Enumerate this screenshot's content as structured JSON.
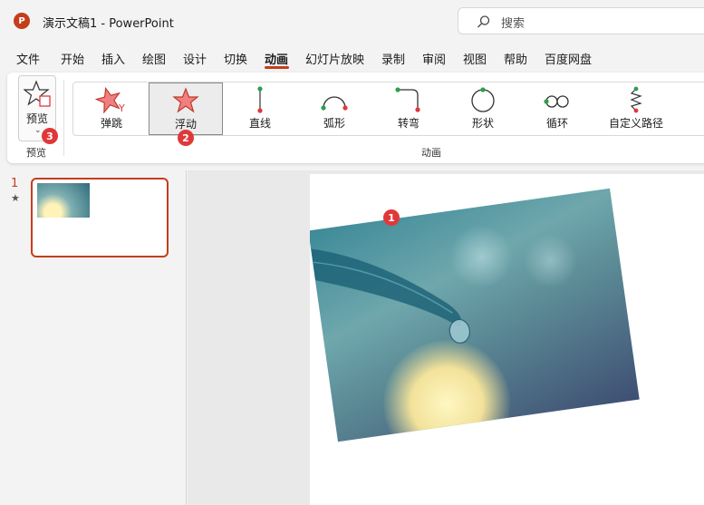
{
  "titlebar": {
    "logo_letter": "P",
    "title": "演示文稿1  -  PowerPoint",
    "search_placeholder": "搜索"
  },
  "menu": {
    "items": [
      "文件",
      "开始",
      "插入",
      "绘图",
      "设计",
      "切换",
      "动画",
      "幻灯片放映",
      "录制",
      "审阅",
      "视图",
      "帮助",
      "百度网盘"
    ],
    "active": "动画"
  },
  "ribbon": {
    "preview_button_label": "预览",
    "preview_group_label": "预览",
    "animation_group_label": "动画",
    "animations": [
      {
        "label": "弹跳",
        "icon": "bounce-star-icon"
      },
      {
        "label": "浮动",
        "icon": "float-star-icon",
        "selected": true
      },
      {
        "label": "直线",
        "icon": "line-path-icon"
      },
      {
        "label": "弧形",
        "icon": "arc-path-icon"
      },
      {
        "label": "转弯",
        "icon": "turn-path-icon"
      },
      {
        "label": "形状",
        "icon": "shape-path-icon"
      },
      {
        "label": "循环",
        "icon": "loop-path-icon"
      },
      {
        "label": "自定义路径",
        "icon": "custom-path-icon"
      }
    ]
  },
  "slides_panel": {
    "slide_number": "1",
    "animation_marker": "★"
  },
  "badges": {
    "slide_image": "1",
    "float_animation": "2",
    "preview": "3"
  },
  "colors": {
    "accent": "#c43e1c",
    "badge": "#e0383a",
    "path_start": "#2e9e4f",
    "path_end": "#e0383a"
  }
}
